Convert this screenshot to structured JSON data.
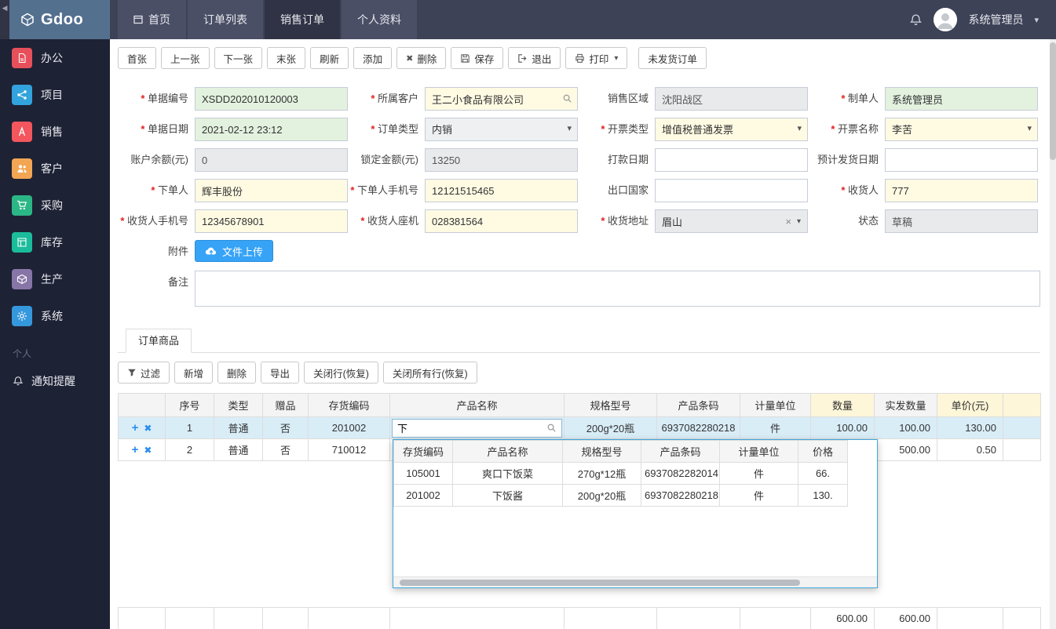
{
  "brand": {
    "name": "Gdoo"
  },
  "icons": {
    "collapse": "◀",
    "caret_down": "▾",
    "plus": "+",
    "row_delete": "✖",
    "delete_x": "✖",
    "clear_x": "×"
  },
  "navbar": {
    "tabs": [
      {
        "label": "首页"
      },
      {
        "label": "订单列表"
      },
      {
        "label": "销售订单"
      },
      {
        "label": "个人资料"
      }
    ],
    "user": {
      "name": "系统管理员"
    }
  },
  "sidebar": {
    "items": [
      {
        "label": "办公",
        "color": "#e7505a"
      },
      {
        "label": "项目",
        "color": "#32a3dc"
      },
      {
        "label": "销售",
        "color": "#f3565d"
      },
      {
        "label": "客户",
        "color": "#f2a654"
      },
      {
        "label": "采购",
        "color": "#2bb686"
      },
      {
        "label": "库存",
        "color": "#1bbc9b"
      },
      {
        "label": "生产",
        "color": "#8775a7"
      },
      {
        "label": "系统",
        "color": "#3598dc"
      }
    ],
    "section": "个人",
    "notice": "通知提醒"
  },
  "toolbar": {
    "first": "首张",
    "prev": "上一张",
    "next": "下一张",
    "last": "末张",
    "refresh": "刷新",
    "add": "添加",
    "delete": "删除",
    "save": "保存",
    "exit": "退出",
    "print": "打印",
    "unshipped": "未发货订单"
  },
  "form": {
    "doc_no": {
      "label": "单据编号",
      "value": "XSDD202010120003"
    },
    "customer": {
      "label": "所属客户",
      "value": "王二小食品有限公司"
    },
    "region": {
      "label": "销售区域",
      "value": "沈阳战区"
    },
    "creator": {
      "label": "制单人",
      "value": "系统管理员"
    },
    "doc_date": {
      "label": "单据日期",
      "value": "2021-02-12 23:12"
    },
    "order_type": {
      "label": "订单类型",
      "value": "内销"
    },
    "invoice_type": {
      "label": "开票类型",
      "value": "增值税普通发票"
    },
    "invoice_name": {
      "label": "开票名称",
      "value": "李苦"
    },
    "balance": {
      "label": "账户余额(元)",
      "value": "0"
    },
    "locked": {
      "label": "锁定金额(元)",
      "value": "13250"
    },
    "pay_date": {
      "label": "打款日期",
      "value": ""
    },
    "est_ship_date": {
      "label": "预计发货日期",
      "value": ""
    },
    "orderer": {
      "label": "下单人",
      "value": "辉丰股份"
    },
    "orderer_phone": {
      "label": "下单人手机号",
      "value": "12121515465"
    },
    "export_country": {
      "label": "出口国家",
      "value": ""
    },
    "consignee": {
      "label": "收货人",
      "value": "777"
    },
    "consignee_phone": {
      "label": "收货人手机号",
      "value": "12345678901"
    },
    "consignee_tel": {
      "label": "收货人座机",
      "value": "028381564"
    },
    "address": {
      "label": "收货地址",
      "value": "眉山"
    },
    "status": {
      "label": "状态",
      "value": "草稿"
    },
    "attachment": {
      "label": "附件",
      "upload": "文件上传"
    },
    "remark": {
      "label": "备注",
      "value": ""
    }
  },
  "items_panel": {
    "tab": "订单商品",
    "toolbar": {
      "filter": "过滤",
      "add": "新增",
      "delete": "删除",
      "export": "导出",
      "close_row": "关闭行(恢复)",
      "close_all": "关闭所有行(恢复)"
    },
    "table": {
      "headers": [
        "",
        "序号",
        "类型",
        "赠品",
        "存货编码",
        "产品名称",
        "规格型号",
        "产品条码",
        "计量单位",
        "数量",
        "实发数量",
        "单价(元)"
      ],
      "rows": [
        {
          "seq": "1",
          "type": "普通",
          "gift": "否",
          "code": "201002",
          "name_input": "下",
          "spec": "200g*20瓶",
          "barcode": "6937082280218",
          "unit": "件",
          "qty": "100.00",
          "actual_qty": "100.00",
          "price": "130.00"
        },
        {
          "seq": "2",
          "type": "普通",
          "gift": "否",
          "code": "710012",
          "actual_qty": "500.00",
          "price": "0.50"
        }
      ],
      "footer": {
        "qty_total": "600.00",
        "actual_qty_total": "600.00"
      }
    }
  },
  "dropdown": {
    "headers": [
      "存货编码",
      "产品名称",
      "规格型号",
      "产品条码",
      "计量单位",
      "价格"
    ],
    "rows": [
      [
        "105001",
        "爽口下饭菜",
        "270g*12瓶",
        "6937082282014",
        "件",
        "66."
      ],
      [
        "201002",
        "下饭酱",
        "200g*20瓶",
        "6937082280218",
        "件",
        "130."
      ]
    ]
  }
}
